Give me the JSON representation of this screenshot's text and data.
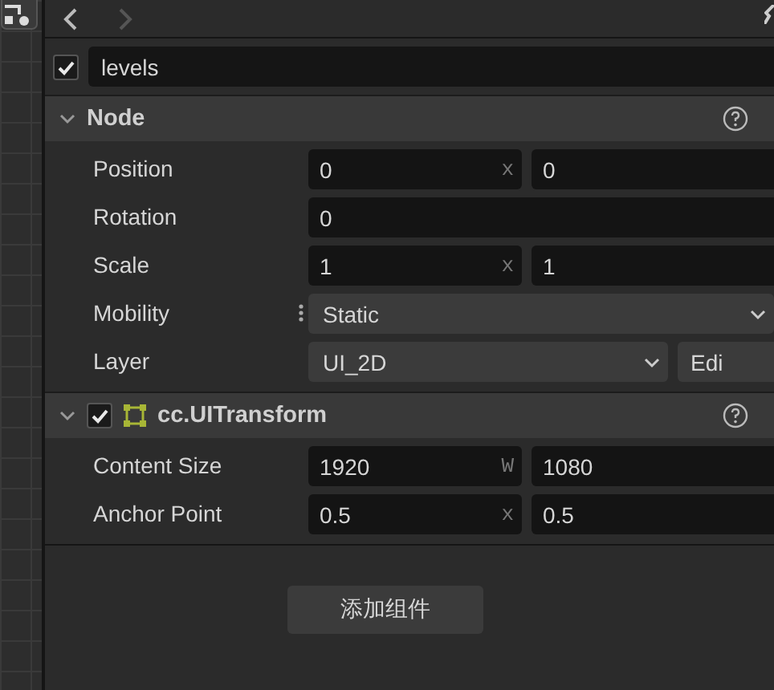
{
  "nav": [
    {
      "kind": "back",
      "disabled": false
    },
    {
      "kind": "forward",
      "disabled": true
    }
  ],
  "node": {
    "active": true,
    "name": "levels"
  },
  "sections": [
    {
      "title": "Node",
      "expanded": true,
      "kind": "node",
      "rows": [
        {
          "kind": "vector",
          "label": "Position",
          "values": [
            {
              "value": "0",
              "axis": "x"
            },
            {
              "value": "0"
            }
          ]
        },
        {
          "kind": "number",
          "label": "Rotation",
          "value": "0"
        },
        {
          "kind": "vector",
          "label": "Scale",
          "values": [
            {
              "value": "1",
              "axis": "x"
            },
            {
              "value": "1"
            }
          ]
        },
        {
          "kind": "select",
          "label": "Mobility",
          "value": "Static"
        },
        {
          "kind": "select_button",
          "label": "Layer",
          "value": "UI_2D",
          "button": "Edi"
        }
      ]
    },
    {
      "title": "cc.UITransform",
      "expanded": true,
      "kind": "component",
      "enabled": true,
      "rows": [
        {
          "kind": "vector",
          "label": "Content Size",
          "values": [
            {
              "value": "1920",
              "axis": "W"
            },
            {
              "value": "1080"
            }
          ]
        },
        {
          "kind": "vector",
          "label": "Anchor Point",
          "values": [
            {
              "value": "0.5",
              "axis": "x"
            },
            {
              "value": "0.5"
            }
          ]
        }
      ]
    }
  ],
  "add_button": "添加组件"
}
